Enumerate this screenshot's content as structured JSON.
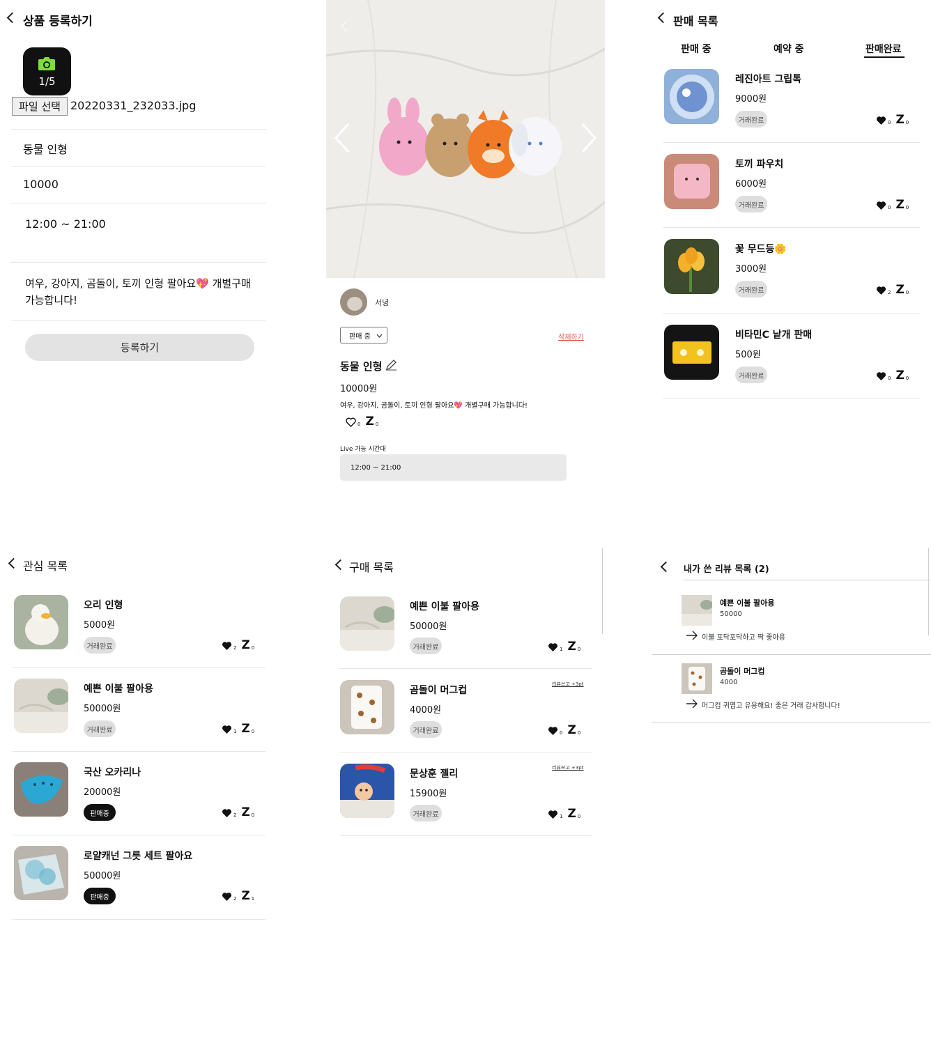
{
  "register": {
    "title": "상품 등록하기",
    "photo_count": "1/5",
    "file_button": "파일 선택",
    "file_name": "20220331_232033.jpg",
    "name_value": "동물 인형",
    "price_value": "10000",
    "time_value": "12:00 ~ 21:00",
    "description_value": "여우, 강아지, 곰돌이, 토끼 인형 팔아요💖 개별구매 가능합니다!",
    "submit_label": "등록하기"
  },
  "detail": {
    "seller_name": "서녕",
    "status_select": "판매 중",
    "delete_label": "삭제하기",
    "product_name": "동물 인형",
    "price": "10000원",
    "description": "여우, 강아지, 곰돌이, 토끼 인형 팔아요💖 개별구매 가능합니다!",
    "likes": "0",
    "zzz": "0",
    "live_label": "Live 가능 시간대",
    "live_time": "12:00 ~ 21:00"
  },
  "sales": {
    "title": "판매 목록",
    "tabs": [
      "판매 중",
      "예약 중",
      "판매완료"
    ],
    "active_tab": "판매완료",
    "items": [
      {
        "name": "레진아트 그립톡",
        "price": "9000원",
        "status": "거래완료",
        "likes": "0",
        "zzz": "0"
      },
      {
        "name": "토끼 파우치",
        "price": "6000원",
        "status": "거래완료",
        "likes": "0",
        "zzz": "0"
      },
      {
        "name": "꽃 무드등🌼",
        "price": "3000원",
        "status": "거래완료",
        "likes": "2",
        "zzz": "0"
      },
      {
        "name": "비타민C 낱개 판매",
        "price": "500원",
        "status": "거래완료",
        "likes": "0",
        "zzz": "0"
      }
    ]
  },
  "wishlist": {
    "title": "관심 목록",
    "items": [
      {
        "name": "오리 인형",
        "price": "5000원",
        "status": "거래완료",
        "likes": "2",
        "zzz": "0"
      },
      {
        "name": "예쁜 이불 팔아용",
        "price": "50000원",
        "status": "거래완료",
        "likes": "1",
        "zzz": "0"
      },
      {
        "name": "국산 오카리나",
        "price": "20000원",
        "status": "판매중",
        "likes": "2",
        "zzz": "0"
      },
      {
        "name": "로얄캐넌 그릇 세트 팔아요",
        "price": "50000원",
        "status": "판매중",
        "likes": "2",
        "zzz": "1"
      }
    ]
  },
  "purchases": {
    "title": "구매 목록",
    "items": [
      {
        "name": "예쁜 이불 팔아용",
        "price": "50000원",
        "status": "거래완료",
        "likes": "1",
        "zzz": "0",
        "review": ""
      },
      {
        "name": "곰돌이 머그컵",
        "price": "4000원",
        "status": "거래완료",
        "likes": "0",
        "zzz": "0",
        "review": "리뷰쓰고 +3pt"
      },
      {
        "name": "문상훈 젤리",
        "price": "15900원",
        "status": "거래완료",
        "likes": "1",
        "zzz": "0",
        "review": "리뷰쓰고 +3pt"
      }
    ]
  },
  "reviews": {
    "title": "내가 쓴 리뷰 목록 (2)",
    "items": [
      {
        "name": "예쁜 이불 팔아용",
        "price": "50000",
        "text": "이불 포닥포닥하고 딱 좋아용"
      },
      {
        "name": "곰돌이 머그컵",
        "price": "4000",
        "text": "머그컵 귀엽고 유용해요! 좋은 거래 감사합니다!"
      }
    ]
  },
  "colors": {
    "camera_bg": "#111111",
    "camera_icon": "#7fdc3a",
    "badge_done_bg": "#dedede",
    "badge_sale_bg": "#111111",
    "delete_link": "#d9534f",
    "input_gray": "#e9e9e9"
  }
}
